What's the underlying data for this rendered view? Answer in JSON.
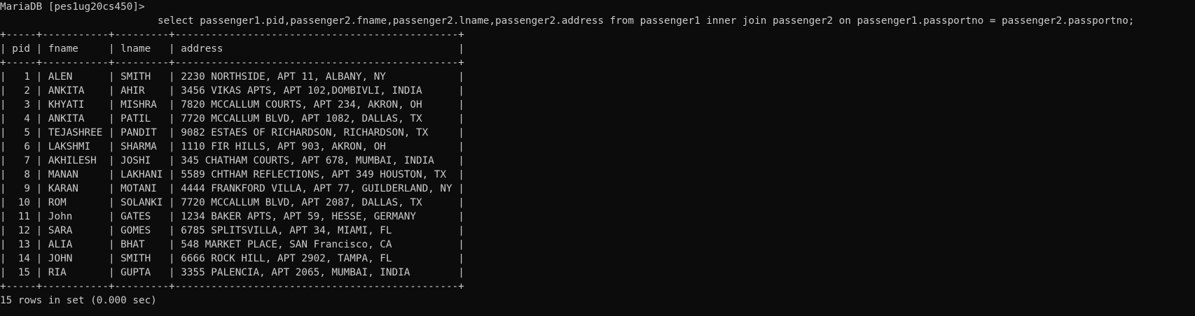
{
  "terminal": {
    "prompt": "MariaDB [pes1ug20cs450]>",
    "query": "select passenger1.pid,passenger2.fname,passenger2.lname,passenger2.address from passenger1 inner join passenger2 on passenger1.passportno = passenger2.passportno;",
    "footer": "15 rows in set (0.000 sec)"
  },
  "table": {
    "columns": [
      "pid",
      "fname",
      "lname",
      "address"
    ],
    "rows": [
      [
        "1",
        "ALEN",
        "SMITH",
        "2230 NORTHSIDE, APT 11, ALBANY, NY"
      ],
      [
        "2",
        "ANKITA",
        "AHIR",
        "3456 VIKAS APTS, APT 102,DOMBIVLI, INDIA"
      ],
      [
        "3",
        "KHYATI",
        "MISHRA",
        "7820 MCCALLUM COURTS, APT 234, AKRON, OH"
      ],
      [
        "4",
        "ANKITA",
        "PATIL",
        "7720 MCCALLUM BLVD, APT 1082, DALLAS, TX"
      ],
      [
        "5",
        "TEJASHREE",
        "PANDIT",
        "9082 ESTAES OF RICHARDSON, RICHARDSON, TX"
      ],
      [
        "6",
        "LAKSHMI",
        "SHARMA",
        "1110 FIR HILLS, APT 903, AKRON, OH"
      ],
      [
        "7",
        "AKHILESH",
        "JOSHI",
        "345 CHATHAM COURTS, APT 678, MUMBAI, INDIA"
      ],
      [
        "8",
        "MANAN",
        "LAKHANI",
        "5589 CHTHAM REFLECTIONS, APT 349 HOUSTON, TX"
      ],
      [
        "9",
        "KARAN",
        "MOTANI",
        "4444 FRANKFORD VILLA, APT 77, GUILDERLAND, NY"
      ],
      [
        "10",
        "ROM",
        "SOLANKI",
        "7720 MCCALLUM BLVD, APT 2087, DALLAS, TX"
      ],
      [
        "11",
        "John",
        "GATES",
        "1234 BAKER APTS, APT 59, HESSE, GERMANY"
      ],
      [
        "12",
        "SARA",
        "GOMES",
        "6785 SPLITSVILLA, APT 34, MIAMI, FL"
      ],
      [
        "13",
        "ALIA",
        "BHAT",
        "548 MARKET PLACE, SAN Francisco, CA"
      ],
      [
        "14",
        "JOHN",
        "SMITH",
        "6666 ROCK HILL, APT 2902, TAMPA, FL"
      ],
      [
        "15",
        "RIA",
        "GUPTA",
        "3355 PALENCIA, APT 2065, MUMBAI, INDIA"
      ]
    ]
  },
  "colors": {
    "background": "#0c0c0c",
    "text": "#cccccc"
  }
}
